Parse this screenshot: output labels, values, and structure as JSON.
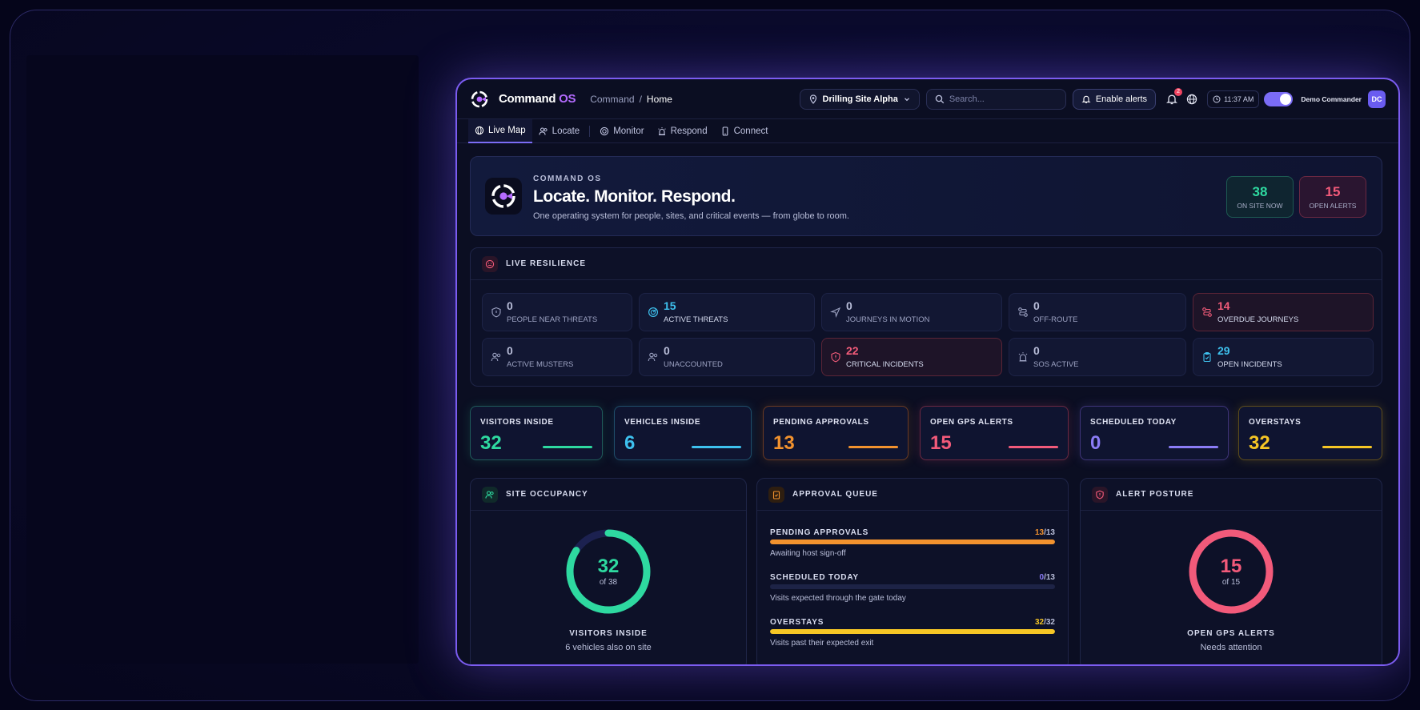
{
  "app": {
    "brand_main": "Command",
    "brand_accent": "OS",
    "breadcrumb": [
      "Command",
      "/",
      "Home"
    ]
  },
  "topbar": {
    "site": "Drilling Site Alpha",
    "search_placeholder": "Search...",
    "enable_alerts": "Enable alerts",
    "notification_count": "2",
    "time": "11:37 AM",
    "user_name": "Demo Commander",
    "user_initials": "DC"
  },
  "nav": {
    "tabs": [
      {
        "label": "Live Map",
        "icon": "globe-icon",
        "active": true
      },
      {
        "label": "Locate",
        "icon": "people-icon",
        "active": false
      },
      {
        "label": "Monitor",
        "icon": "radar-icon",
        "active": false
      },
      {
        "label": "Respond",
        "icon": "siren-icon",
        "active": false
      },
      {
        "label": "Connect",
        "icon": "phone-icon",
        "active": false
      }
    ]
  },
  "hero": {
    "eyebrow": "COMMAND OS",
    "title": "Locate. Monitor. Respond.",
    "subtitle": "One operating system for people, sites, and critical events — from globe to room.",
    "stats": [
      {
        "value": "38",
        "label": "ON SITE NOW"
      },
      {
        "value": "15",
        "label": "OPEN ALERTS"
      }
    ]
  },
  "resilience": {
    "title": "LIVE RESILIENCE",
    "tiles": [
      {
        "value": "0",
        "label": "PEOPLE NEAR THREATS",
        "icon": "shield-icon"
      },
      {
        "value": "15",
        "label": "ACTIVE THREATS",
        "icon": "radar-icon"
      },
      {
        "value": "0",
        "label": "JOURNEYS IN MOTION",
        "icon": "navigation-icon"
      },
      {
        "value": "0",
        "label": "OFF-ROUTE",
        "icon": "route-icon"
      },
      {
        "value": "14",
        "label": "OVERDUE JOURNEYS",
        "icon": "route-icon"
      },
      {
        "value": "0",
        "label": "ACTIVE MUSTERS",
        "icon": "people-icon"
      },
      {
        "value": "0",
        "label": "UNACCOUNTED",
        "icon": "people-icon"
      },
      {
        "value": "22",
        "label": "CRITICAL INCIDENTS",
        "icon": "shield-alert-icon"
      },
      {
        "value": "0",
        "label": "SOS ACTIVE",
        "icon": "siren-icon"
      },
      {
        "value": "29",
        "label": "OPEN INCIDENTS",
        "icon": "clipboard-icon"
      }
    ]
  },
  "kpis": [
    {
      "label": "VISITORS INSIDE",
      "value": "32",
      "color": "#2ed9a0"
    },
    {
      "label": "VEHICLES INSIDE",
      "value": "6",
      "color": "#3ec1ee"
    },
    {
      "label": "PENDING APPROVALS",
      "value": "13",
      "color": "#f2922e"
    },
    {
      "label": "OPEN GPS ALERTS",
      "value": "15",
      "color": "#f25a7a"
    },
    {
      "label": "SCHEDULED TODAY",
      "value": "0",
      "color": "#8b7cf6"
    },
    {
      "label": "OVERSTAYS",
      "value": "32",
      "color": "#f6c625"
    }
  ],
  "occupancy": {
    "title": "SITE OCCUPANCY",
    "value": "32",
    "of": "of 38",
    "fraction": 0.842,
    "caption": "VISITORS INSIDE",
    "note": "6 vehicles also on site"
  },
  "approval_queue": {
    "title": "APPROVAL QUEUE",
    "rows": [
      {
        "label": "PENDING APPROVALS",
        "value": "13",
        "total": "/13",
        "fraction": 1.0,
        "note": "Awaiting host sign-off",
        "color": "#f2922e"
      },
      {
        "label": "SCHEDULED TODAY",
        "value": "0",
        "total": "/13",
        "fraction": 0.0,
        "note": "Visits expected through the gate today",
        "color": "#8b7cf6"
      },
      {
        "label": "OVERSTAYS",
        "value": "32",
        "total": "/32",
        "fraction": 1.0,
        "note": "Visits past their expected exit",
        "color": "#f6c625"
      }
    ]
  },
  "alert_posture": {
    "title": "ALERT POSTURE",
    "value": "15",
    "of": "of 15",
    "fraction": 1.0,
    "caption": "OPEN GPS ALERTS",
    "note": "Needs attention"
  },
  "colors": {
    "accent": "#7b6cf5",
    "green": "#2ed9a0",
    "red": "#f25a7a",
    "orange": "#f2922e",
    "yellow": "#f6c625",
    "cyan": "#3ec1ee"
  }
}
